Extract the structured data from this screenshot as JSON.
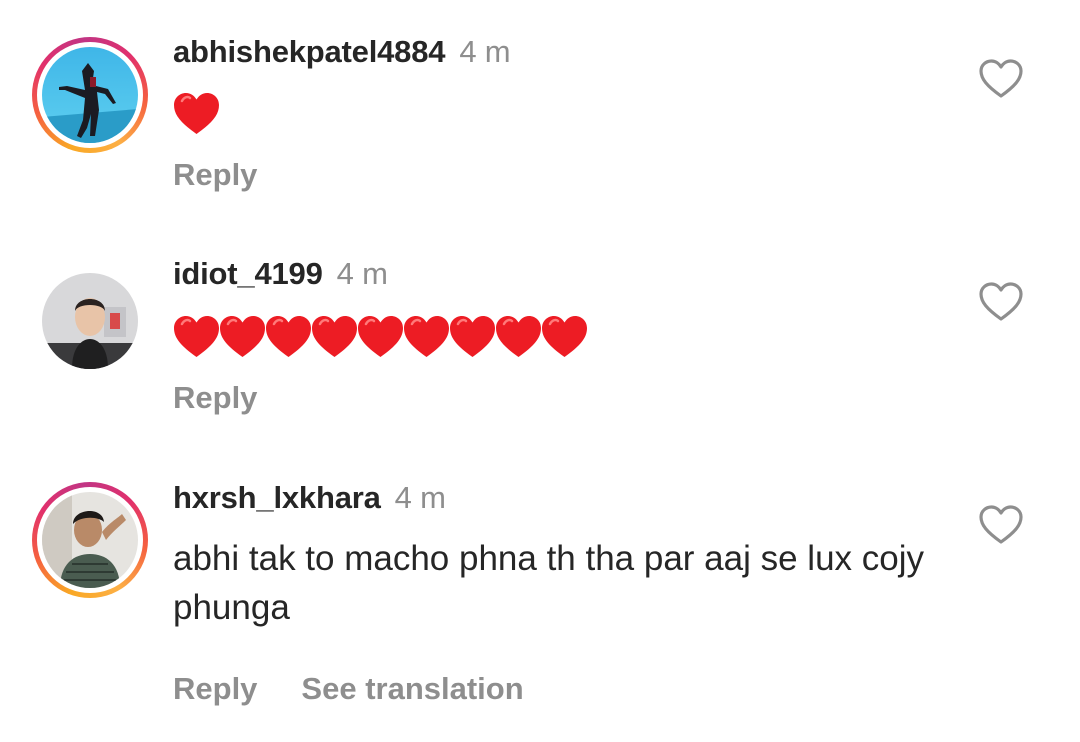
{
  "comments": [
    {
      "username": "abhishekpatel4884",
      "time": "4 m",
      "text": "",
      "emoji": "red-heart",
      "emoji_count": 1,
      "has_story_ring": true,
      "actions": {
        "reply": "Reply"
      }
    },
    {
      "username": "idiot_4199",
      "time": "4 m",
      "text": "",
      "emoji": "red-heart",
      "emoji_count": 9,
      "has_story_ring": false,
      "actions": {
        "reply": "Reply"
      }
    },
    {
      "username": "hxrsh_lxkhara",
      "time": "4 m",
      "text": "abhi tak to macho phna th tha par aaj se lux cojy phunga",
      "has_story_ring": true,
      "actions": {
        "reply": "Reply",
        "translate": "See translation"
      }
    }
  ],
  "colors": {
    "text_primary": "#262626",
    "text_secondary": "#8e8e8e",
    "heart_red": "#ed1c24"
  },
  "icons": {
    "like": "heart-outline-icon",
    "emoji": "red-heart-emoji"
  }
}
